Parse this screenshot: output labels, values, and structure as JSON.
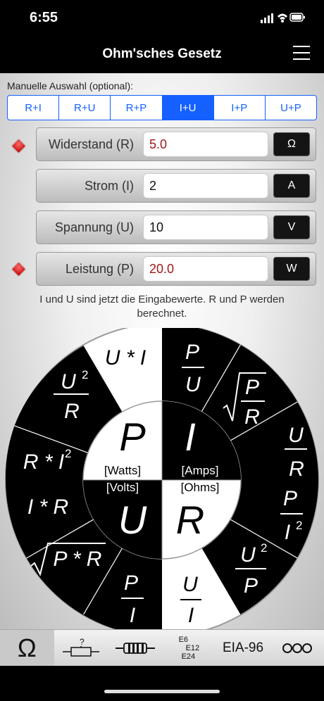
{
  "status": {
    "time": "6:55"
  },
  "nav": {
    "title": "Ohm'sches Gesetz"
  },
  "selection": {
    "label": "Manuelle Auswahl (optional):",
    "options": [
      "R+I",
      "R+U",
      "R+P",
      "I+U",
      "I+P",
      "U+P"
    ],
    "active": "I+U"
  },
  "fields": [
    {
      "label": "Widerstand (R)",
      "value": "5.0",
      "unit": "Ω",
      "calculated": true
    },
    {
      "label": "Strom (I)",
      "value": "2",
      "unit": "A",
      "calculated": false
    },
    {
      "label": "Spannung (U)",
      "value": "10",
      "unit": "V",
      "calculated": false
    },
    {
      "label": "Leistung (P)",
      "value": "20.0",
      "unit": "W",
      "calculated": true
    }
  ],
  "hint": "I und U sind jetzt die Eingabewerte. R und P werden berechnet.",
  "wheel": {
    "center": {
      "P": {
        "symbol": "P",
        "unit": "[Watts]"
      },
      "I": {
        "symbol": "I",
        "unit": "[Amps]"
      },
      "U": {
        "symbol": "U",
        "unit": "[Volts]"
      },
      "R": {
        "symbol": "R",
        "unit": "[Ohms]"
      }
    },
    "formulas": {
      "P": [
        "U * I",
        "U²/R",
        "R * I²"
      ],
      "I": [
        "P/U",
        "√(P/R)",
        "U/R"
      ],
      "R": [
        "P/I²",
        "U²/P",
        "U/I"
      ],
      "U": [
        "P/I",
        "√(P * R)",
        "I * R"
      ]
    }
  },
  "tabs": [
    {
      "name": "ohm",
      "label": "Ω",
      "active": true
    },
    {
      "name": "potentiometer",
      "label": "?"
    },
    {
      "name": "resistor",
      "label": ""
    },
    {
      "name": "eseries",
      "label": "E6\nE12\nE24"
    },
    {
      "name": "eia96",
      "label": "EIA-96"
    },
    {
      "name": "more",
      "label": "OOO"
    }
  ],
  "colors": {
    "accent": "#1560ff",
    "calculated": "#a01818",
    "marker": "#d00000"
  }
}
